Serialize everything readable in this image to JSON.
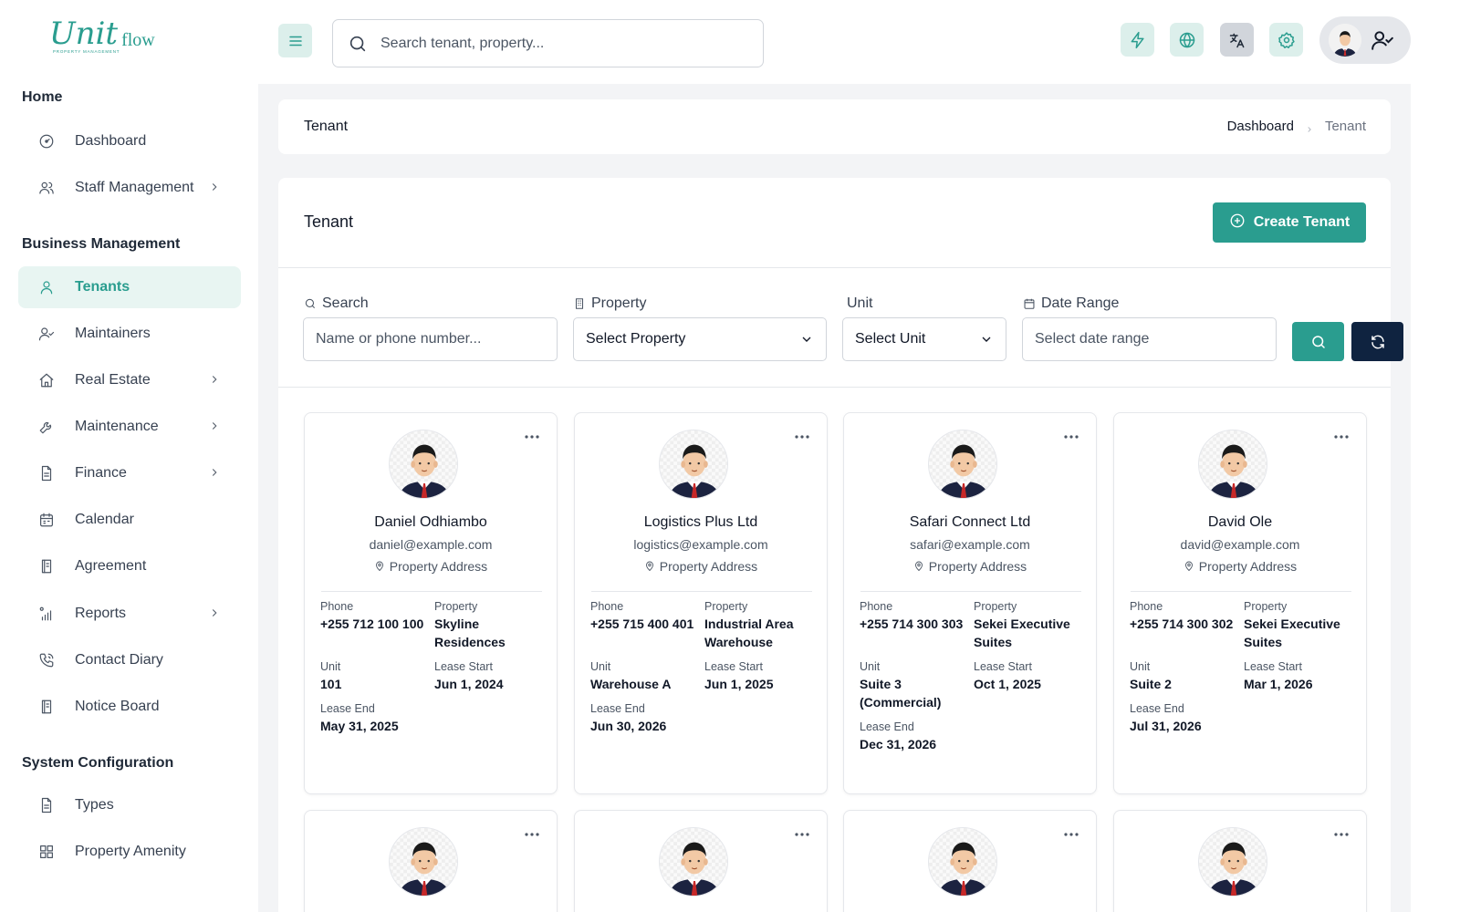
{
  "brand": {
    "script": "Unit",
    "text": "flow",
    "sub": "PROPERTY MANAGEMENT"
  },
  "sidebar": {
    "sections": [
      "Home",
      "Business Management",
      "System Configuration"
    ],
    "items": [
      {
        "label": "Dashboard"
      },
      {
        "label": "Staff Management"
      },
      {
        "label": "Tenants"
      },
      {
        "label": "Maintainers"
      },
      {
        "label": "Real Estate"
      },
      {
        "label": "Maintenance"
      },
      {
        "label": "Finance"
      },
      {
        "label": "Calendar"
      },
      {
        "label": "Agreement"
      },
      {
        "label": "Reports"
      },
      {
        "label": "Contact Diary"
      },
      {
        "label": "Notice Board"
      },
      {
        "label": "Types"
      },
      {
        "label": "Property Amenity"
      }
    ]
  },
  "topbar": {
    "search_placeholder": "Search tenant, property..."
  },
  "breadcrumb": {
    "title": "Tenant",
    "parent": "Dashboard",
    "current": "Tenant"
  },
  "panel": {
    "title": "Tenant",
    "create_label": "Create Tenant",
    "filters": {
      "search_label": "Search",
      "search_placeholder": "Name or phone number...",
      "property_label": "Property",
      "property_value": "Select Property",
      "unit_label": "Unit",
      "unit_value": "Select Unit",
      "date_label": "Date Range",
      "date_placeholder": "Select date range"
    }
  },
  "card_labels": {
    "phone": "Phone",
    "property": "Property",
    "unit": "Unit",
    "lease_start": "Lease Start",
    "lease_end": "Lease End",
    "address": "Property Address"
  },
  "tenants": [
    {
      "name": "Daniel Odhiambo",
      "email": "daniel@example.com",
      "phone": "+255 712 100 100",
      "property": "Skyline Residences",
      "unit": "101",
      "lease_start": "Jun 1, 2024",
      "lease_end": "May 31, 2025"
    },
    {
      "name": "Logistics Plus Ltd",
      "email": "logistics@example.com",
      "phone": "+255 715 400 401",
      "property": "Industrial Area Warehouse",
      "unit": "Warehouse A",
      "lease_start": "Jun 1, 2025",
      "lease_end": "Jun 30, 2026"
    },
    {
      "name": "Safari Connect Ltd",
      "email": "safari@example.com",
      "phone": "+255 714 300 303",
      "property": "Sekei Executive Suites",
      "unit": "Suite 3 (Commercial)",
      "lease_start": "Oct 1, 2025",
      "lease_end": "Dec 31, 2026"
    },
    {
      "name": "David Ole",
      "email": "david@example.com",
      "phone": "+255 714 300 302",
      "property": "Sekei Executive Suites",
      "unit": "Suite 2",
      "lease_start": "Mar 1, 2026",
      "lease_end": "Jul 31, 2026"
    }
  ],
  "colors": {
    "accent": "#2a9d8f",
    "accent_light": "#e8f5f2",
    "dark": "#0f2340"
  }
}
